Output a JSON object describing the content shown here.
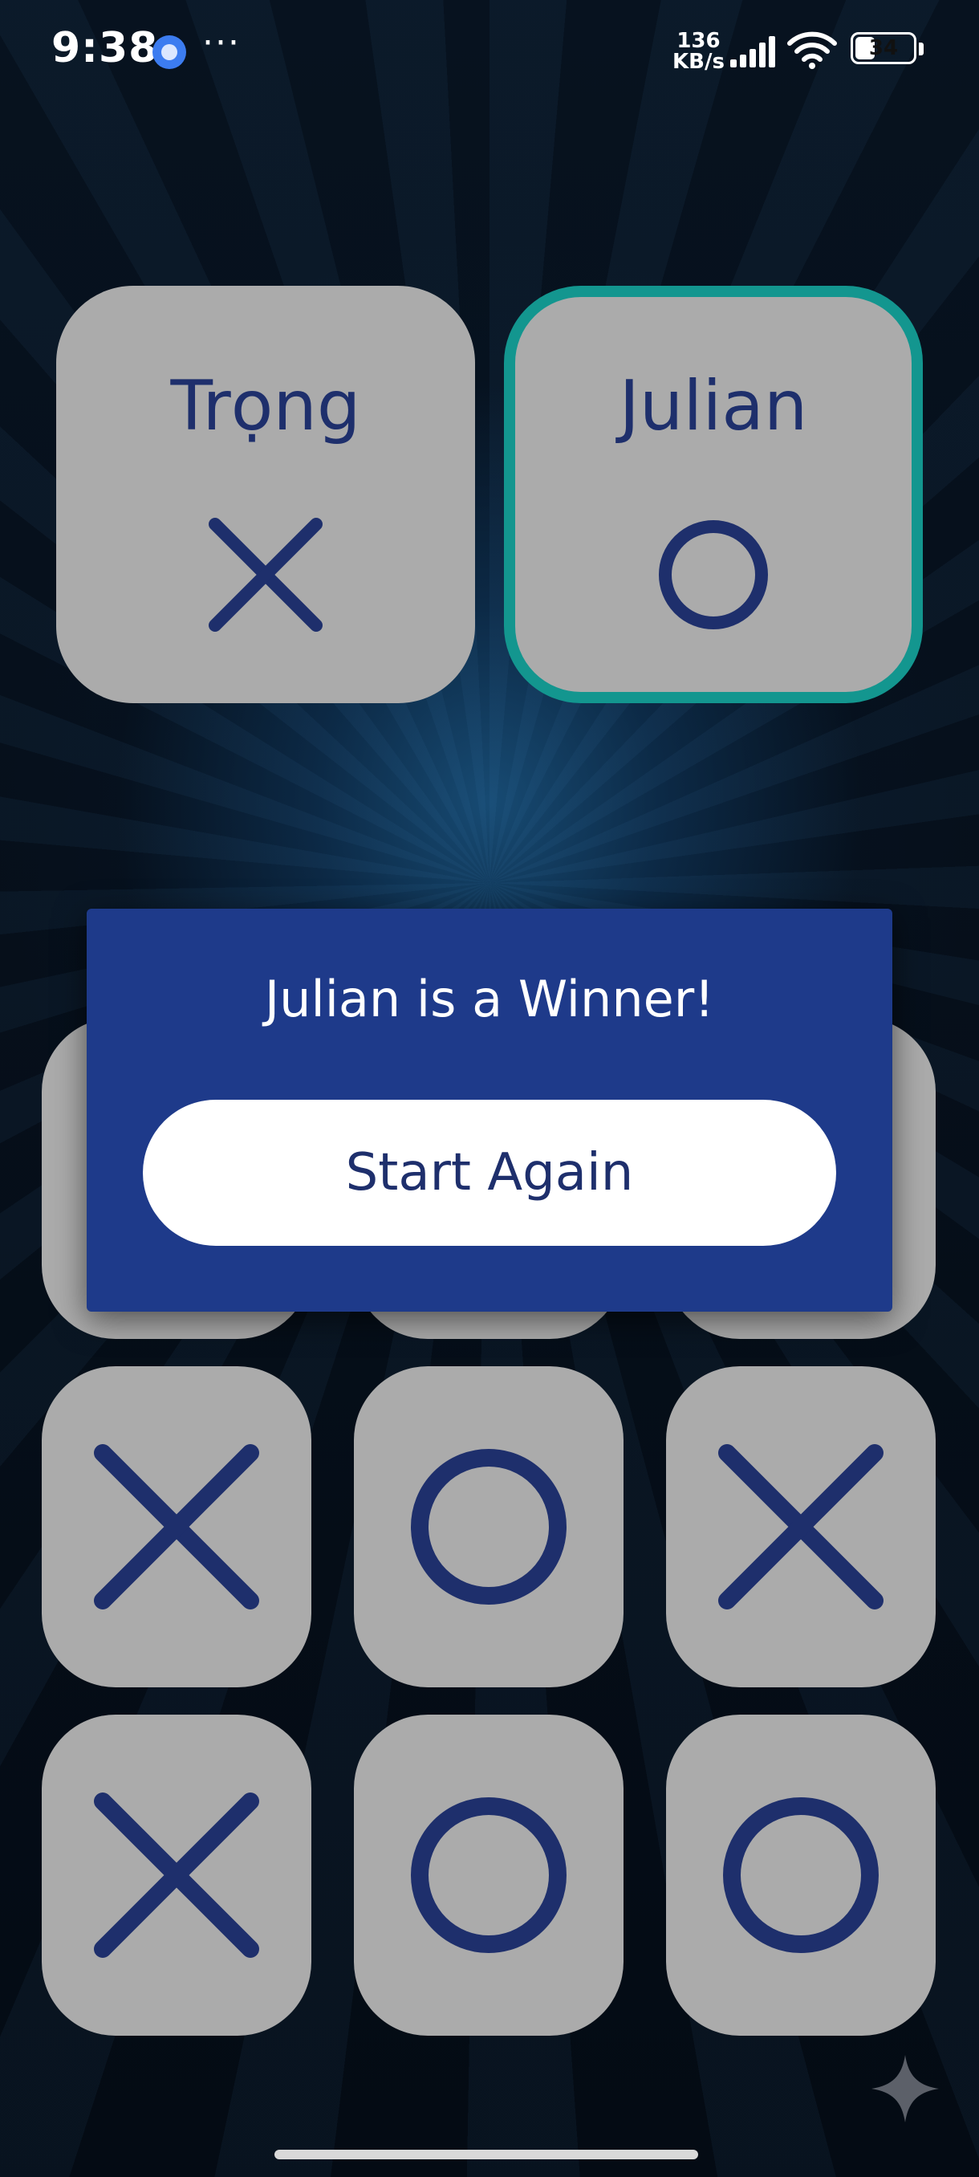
{
  "status_bar": {
    "time": "9:38",
    "more": "···",
    "speed_value": "136",
    "speed_unit": "KB/s",
    "battery": "34",
    "battery_level": 0.34,
    "icons": [
      "messenger-icon",
      "more-icon",
      "signal-icon",
      "wifi-icon",
      "battery-icon"
    ]
  },
  "players": [
    {
      "name": "Trọng",
      "symbol": "X",
      "active": false
    },
    {
      "name": "Julian",
      "symbol": "O",
      "active": true
    }
  ],
  "board": {
    "rows": [
      [
        "",
        "",
        ""
      ],
      [
        "X",
        "O",
        "X"
      ],
      [
        "X",
        "O",
        "O"
      ]
    ],
    "note": ""
  },
  "dialog": {
    "message": "Julian is a Winner!",
    "button_label": "Start Again"
  },
  "colors": {
    "card": "#ababab",
    "symbol": "#1e2f6c",
    "active_border": "#13968f",
    "dialog": "#1e3a8a"
  }
}
